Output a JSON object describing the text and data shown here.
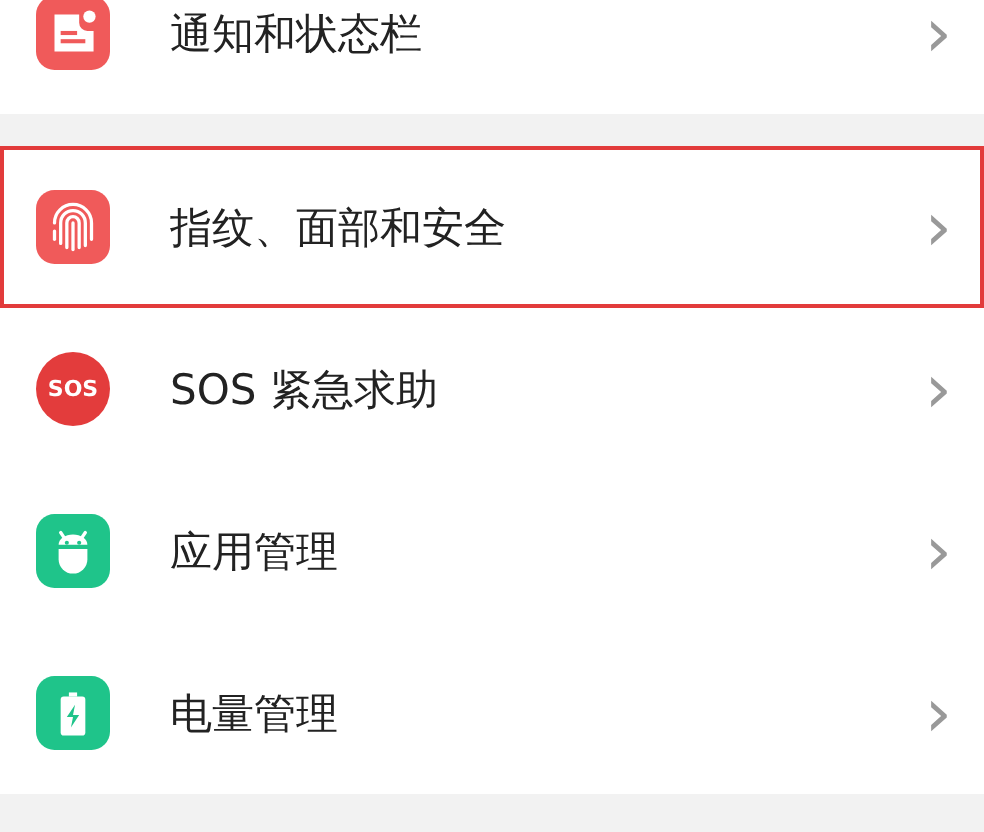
{
  "groups": [
    {
      "items": [
        {
          "kind": "notification",
          "label": "通知和状态栏",
          "chevron": "›",
          "selected": false
        }
      ]
    },
    {
      "items": [
        {
          "kind": "fingerprint",
          "label": "指纹、面部和安全",
          "chevron": "›",
          "selected": true
        },
        {
          "kind": "sos",
          "icon_text": "SOS",
          "label": "SOS 紧急求助",
          "chevron": "›",
          "selected": false
        },
        {
          "kind": "app",
          "label": "应用管理",
          "chevron": "›",
          "selected": false
        },
        {
          "kind": "battery",
          "label": "电量管理",
          "chevron": "›",
          "selected": false
        }
      ]
    }
  ]
}
